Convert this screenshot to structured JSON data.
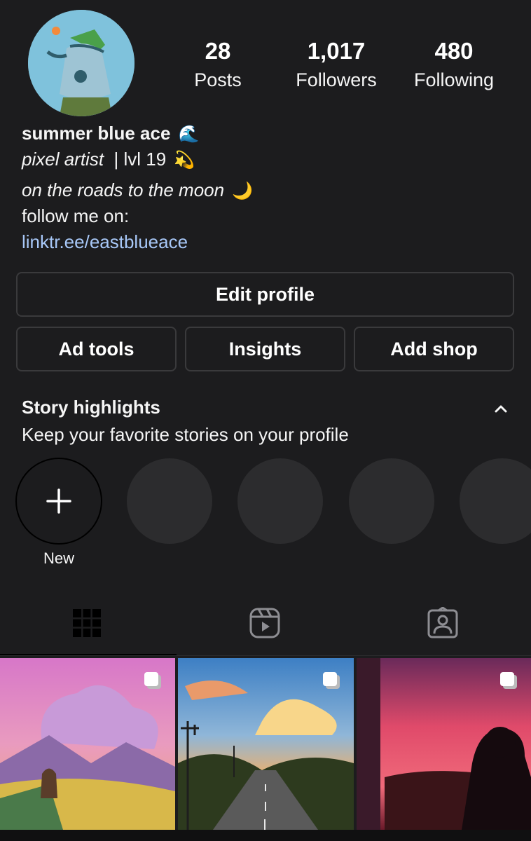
{
  "profile": {
    "stats": [
      {
        "value": "28",
        "label": "Posts"
      },
      {
        "value": "1,017",
        "label": "Followers"
      },
      {
        "value": "480",
        "label": "Following"
      }
    ],
    "name": "summer blue ace",
    "name_emoji": "🌊",
    "role_italic": "pixel artist",
    "role_rest": "  | lvl 19",
    "role_emoji": "💫",
    "tagline": "on the roads to the moon",
    "tagline_emoji": "🌙",
    "follow_text": "follow me on:",
    "link": "linktr.ee/eastblueace"
  },
  "buttons": {
    "edit": "Edit profile",
    "ad_tools": "Ad tools",
    "insights": "Insights",
    "add_shop": "Add shop"
  },
  "highlights": {
    "title": "Story highlights",
    "subtitle": "Keep your favorite stories on your profile",
    "new_label": "New"
  },
  "tabs": [
    {
      "icon": "grid-icon",
      "active": true
    },
    {
      "icon": "reels-icon",
      "active": false
    },
    {
      "icon": "tagged-icon",
      "active": false
    }
  ],
  "posts": [
    {
      "icon": "multi-post-icon"
    },
    {
      "icon": "multi-post-icon"
    },
    {
      "icon": "multi-post-icon"
    }
  ],
  "colors": {
    "background": "#1c1c1e",
    "link": "#a8c8f8",
    "button_border": "#3a3a3c",
    "placeholder_circle": "#2c2c2e"
  }
}
